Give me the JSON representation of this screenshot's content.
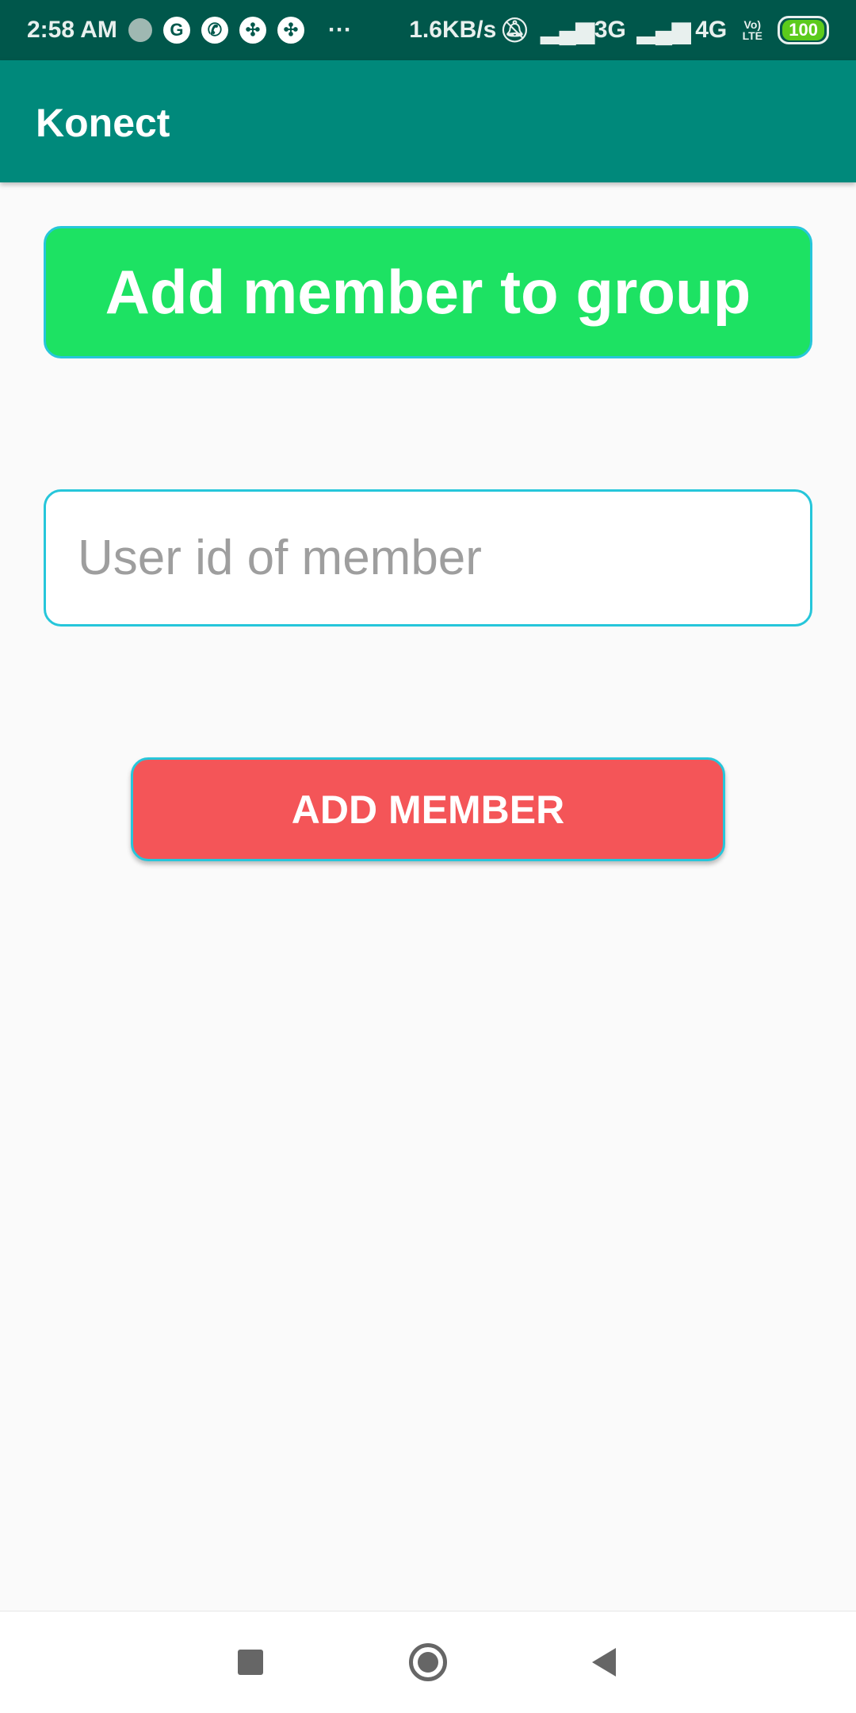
{
  "status_bar": {
    "time": "2:58 AM",
    "more": "···",
    "net_speed": "1.6KB/s",
    "sim1": "3G",
    "sim2": "4G",
    "volte": "Vo) LTE",
    "battery": "100"
  },
  "app_bar": {
    "title": "Konect"
  },
  "main": {
    "heading": "Add member to group",
    "user_id_placeholder": "User id of member",
    "add_button": "ADD MEMBER"
  },
  "colors": {
    "status": "#00574b",
    "appbar": "#00897b",
    "heading": "#1de263",
    "button": "#f45558",
    "border": "#26c6da"
  }
}
